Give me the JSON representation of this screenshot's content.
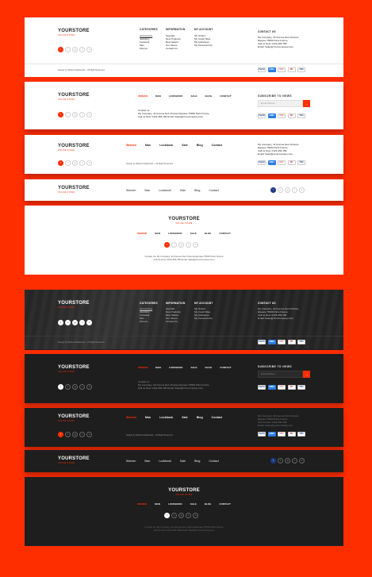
{
  "brand": {
    "name": "YOURSTORE",
    "tagline": "ONLINE STORE"
  },
  "columns": {
    "categories": {
      "title": "CATEGORIES",
      "items": [
        "Accessories",
        "Jewellery",
        "Footwear",
        "Men",
        "Women"
      ]
    },
    "information": {
      "title": "INFORMATION",
      "items": [
        "Specials",
        "New Products",
        "Best Sellers",
        "Our Stores",
        "Contact Us"
      ]
    },
    "account": {
      "title": "MY ACCOUNT",
      "items": [
        "My Orders",
        "My Credit Slips",
        "My Addresses",
        "My Personal Info"
      ]
    },
    "contact": {
      "title": "CONTACT US",
      "lines": [
        "My Company, 42 Avenue Des Champs",
        "Elysées 75000 Paris France",
        "Call us Now: 0123-456-789",
        "Email: Sales@Yourcompany.Com"
      ]
    }
  },
  "copyright": "Design by Webud Intelsbunds – All Right Reserved",
  "nav": {
    "items": [
      "WOMAN",
      "MAN",
      "LOOKBOOK",
      "SALE",
      "BLOG",
      "CONTACT"
    ]
  },
  "nav_title": {
    "items": [
      "Women",
      "Man",
      "Lookbook",
      "Sale",
      "Blog",
      "Contact"
    ]
  },
  "subscribe": {
    "label": "SUBSCRIBE TO NEWS",
    "placeholder": "Email address",
    "button": "→"
  },
  "contact_block": {
    "title": "Contact us",
    "lines": [
      "My Company, 42 Avenue Des Champs Elysées 75000 Paris France",
      "Call us Now: 0123-456-789 Email: Sales@Yourcompany.Com"
    ]
  },
  "contact_short": {
    "lines": [
      "My Company, 42 Avenue Des Champs",
      "Elysées 75000 Paris France",
      "Call us Now: 0123-456-789",
      "Email: Sales@yourcompany.com"
    ]
  },
  "contact_center": {
    "lines": [
      "Contact Us: My Company, 42 Avenue Des Champs Elysées 75000 Paris France",
      "Call Us Now: 0123-456-789 Email: Sales@Yourcompany.Com"
    ]
  },
  "payments": [
    "PayPal",
    "AMEX",
    "DISC",
    "MC",
    "VISA"
  ],
  "social": [
    {
      "icon": "facebook-icon",
      "glyph": "f"
    },
    {
      "icon": "twitter-icon",
      "glyph": "t"
    },
    {
      "icon": "google-plus-icon",
      "glyph": "g"
    },
    {
      "icon": "tumblr-icon",
      "glyph": "t"
    },
    {
      "icon": "vk-icon",
      "glyph": "v"
    }
  ],
  "colors": {
    "accent": "#ff2e00",
    "dark_bg": "#1e1e1e",
    "light_bg": "#ffffff"
  }
}
